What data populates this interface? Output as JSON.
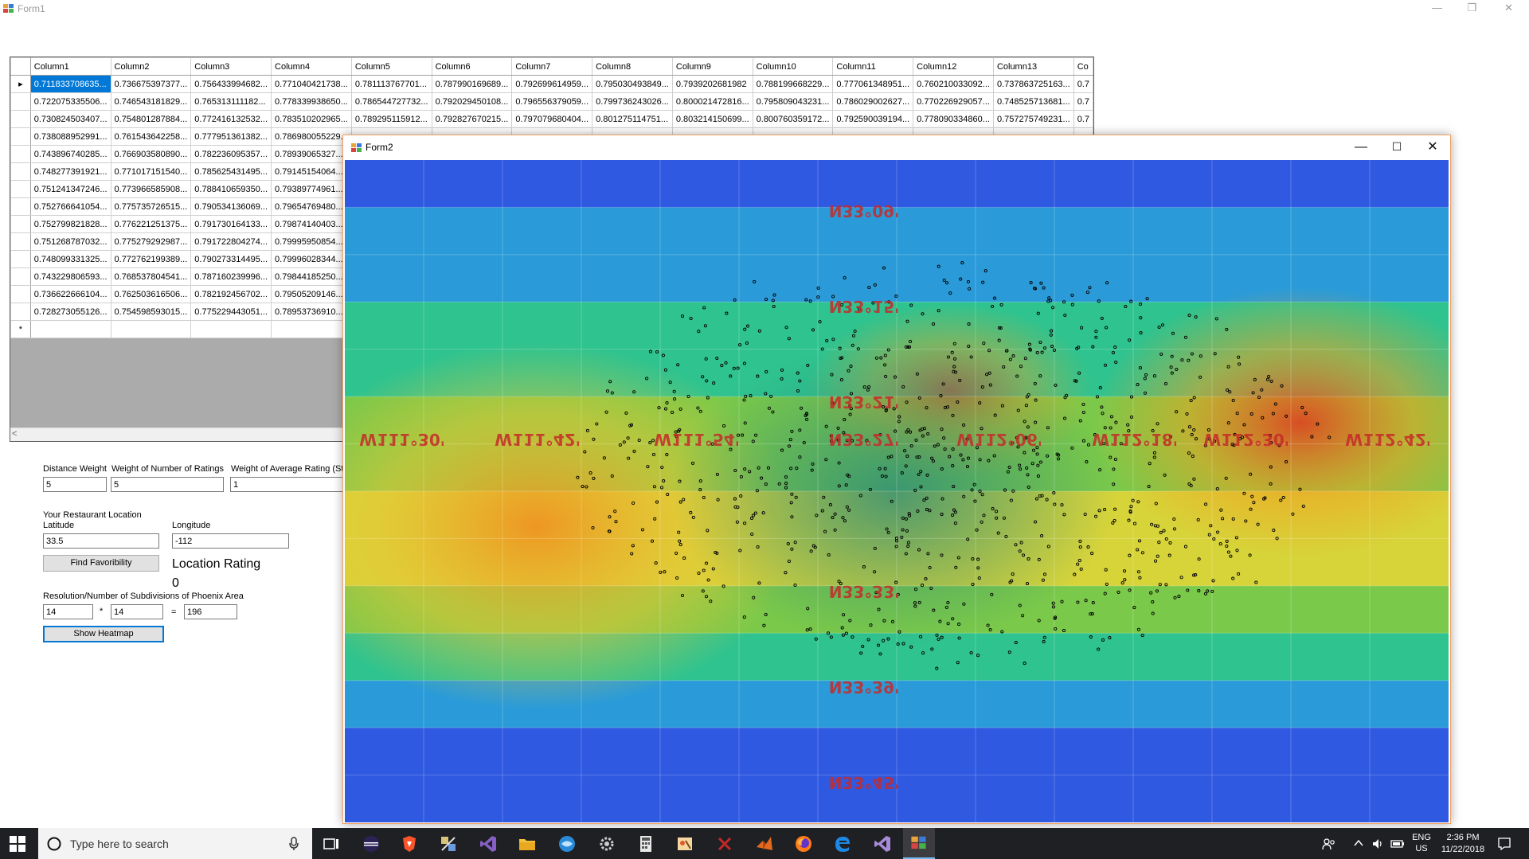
{
  "form1": {
    "title": "Form1",
    "grid": {
      "headers": [
        "Column1",
        "Column2",
        "Column3",
        "Column4",
        "Column5",
        "Column6",
        "Column7",
        "Column8",
        "Column9",
        "Column10",
        "Column11",
        "Column12",
        "Column13",
        "Co"
      ],
      "rows": [
        [
          "0.711833708635...",
          "0.736675397377...",
          "0.756433994682...",
          "0.771040421738...",
          "0.781113767701...",
          "0.787990169689...",
          "0.792699614959...",
          "0.795030493849...",
          "0.7939202681982",
          "0.788199668229...",
          "0.777061348951...",
          "0.760210033092...",
          "0.737863725163...",
          "0.7"
        ],
        [
          "0.722075335506...",
          "0.746543181829...",
          "0.765313111182...",
          "0.778339938650...",
          "0.786544727732...",
          "0.792029450108...",
          "0.796556379059...",
          "0.799736243026...",
          "0.800021472816...",
          "0.795809043231...",
          "0.786029002627...",
          "0.770226929057...",
          "0.748525713681...",
          "0.7"
        ],
        [
          "0.730824503407...",
          "0.754801287884...",
          "0.772416132532...",
          "0.783510202965...",
          "0.789295115912...",
          "0.792827670215...",
          "0.797079680404...",
          "0.801275114751...",
          "0.803214150699...",
          "0.800760359172...",
          "0.792590039194...",
          "0.778090334860...",
          "0.757275749231...",
          "0.7"
        ],
        [
          "0.738088952991...",
          "0.761543642258...",
          "0.777951361382...",
          "0.786980055229...",
          "",
          "",
          "",
          "",
          "",
          "",
          "",
          "",
          "",
          ""
        ],
        [
          "0.743896740285...",
          "0.766903580890...",
          "0.782236095357...",
          "0.78939065327...",
          "",
          "",
          "",
          "",
          "",
          "",
          "",
          "",
          "",
          ""
        ],
        [
          "0.748277391921...",
          "0.771017151540...",
          "0.785625431495...",
          "0.79145154064...",
          "",
          "",
          "",
          "",
          "",
          "",
          "",
          "",
          "",
          ""
        ],
        [
          "0.751241347246...",
          "0.773966585908...",
          "0.788410659350...",
          "0.79389774961...",
          "",
          "",
          "",
          "",
          "",
          "",
          "",
          "",
          "",
          ""
        ],
        [
          "0.752766641054...",
          "0.775735726515...",
          "0.790534136069...",
          "0.79654769480...",
          "",
          "",
          "",
          "",
          "",
          "",
          "",
          "",
          "",
          ""
        ],
        [
          "0.752799821828...",
          "0.776221251375...",
          "0.791730164133...",
          "0.79874140403...",
          "",
          "",
          "",
          "",
          "",
          "",
          "",
          "",
          "",
          ""
        ],
        [
          "0.751268787032...",
          "0.775279292987...",
          "0.791722804274...",
          "0.79995950854...",
          "",
          "",
          "",
          "",
          "",
          "",
          "",
          "",
          "",
          ""
        ],
        [
          "0.748099331325...",
          "0.772762199389...",
          "0.790273314495...",
          "0.79996028344...",
          "",
          "",
          "",
          "",
          "",
          "",
          "",
          "",
          "",
          ""
        ],
        [
          "0.743229806593...",
          "0.768537804541...",
          "0.787160239996...",
          "0.79844185250...",
          "",
          "",
          "",
          "",
          "",
          "",
          "",
          "",
          "",
          ""
        ],
        [
          "0.736622666104...",
          "0.762503616506...",
          "0.782192456702...",
          "0.79505209146...",
          "",
          "",
          "",
          "",
          "",
          "",
          "",
          "",
          "",
          ""
        ],
        [
          "0.728273055126...",
          "0.754598593015...",
          "0.775229443051...",
          "0.78953736910...",
          "",
          "",
          "",
          "",
          "",
          "",
          "",
          "",
          "",
          ""
        ]
      ],
      "current_row_glyph": "▸",
      "new_row_glyph": "*",
      "scroll_left_glyph": "<"
    },
    "weights": {
      "distance_label": "Distance Weight",
      "distance_value": "5",
      "num_ratings_label": "Weight of Number of Ratings",
      "num_ratings_value": "5",
      "avg_rating_label": "Weight of Average Rating (St",
      "avg_rating_value": "1"
    },
    "location": {
      "section_label": "Your Restaurant Location",
      "latitude_label": "Latitude",
      "latitude_value": "33.5",
      "longitude_label": "Longitude",
      "longitude_value": "-112",
      "find_button": "Find Favoribility",
      "rating_label": "Location Rating",
      "rating_value": "0"
    },
    "resolution": {
      "label": "Resolution/Number of Subdivisions of Phoenix Area",
      "x_value": "14",
      "times": "*",
      "y_value": "14",
      "equals": "=",
      "total_value": "196",
      "show_button": "Show Heatmap"
    }
  },
  "form2": {
    "title": "Form2",
    "map_labels": {
      "lat": [
        "N33°09'",
        "N33°15'",
        "N33°21'",
        "N33°33'",
        "N33°39'",
        "N33°45'"
      ],
      "lon": [
        "W111°30'",
        "W111°42'",
        "W111°54'",
        "W112°06'",
        "W112°18'",
        "W112°30'",
        "W112°42'"
      ],
      "center": "N33°27'"
    }
  },
  "heatmap_colors": [
    "#2f59e0",
    "#2a9bd8",
    "#2fc38f",
    "#7bc94a",
    "#d7d43a",
    "#f09a2a",
    "#e24a24"
  ],
  "taskbar": {
    "search_placeholder": "Type here to search",
    "lang_line1": "ENG",
    "lang_line2": "US",
    "time": "2:36 PM",
    "date": "11/22/2018"
  }
}
